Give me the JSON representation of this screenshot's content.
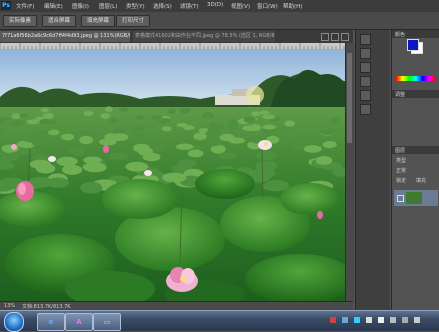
{
  "menubar": {
    "app_logo": "Ps",
    "items": [
      "文件(F)",
      "编辑(E)",
      "图像(I)",
      "图层(L)",
      "类型(Y)",
      "选择(S)",
      "滤镜(T)",
      "3D(D)",
      "视图(V)",
      "窗口(W)",
      "帮助(H)"
    ]
  },
  "options_bar": {
    "buttons": [
      "实际像素",
      "适合屏幕",
      "填充屏幕",
      "打印尺寸"
    ]
  },
  "tabs": {
    "active": "7f71a6f56b2a6c9c6d7ff4f4d93.jpeg @ 131%(RGB/8) *",
    "inactive": "表格模式41602和由作业不同.jpeg @ 78.5% (选区 1, RGB/8)"
  },
  "status": {
    "zoom": "13%",
    "doc": "文档:813.7K/813.7K"
  },
  "right_panel": {
    "labels": [
      "颜色",
      "调整",
      "图层",
      "类型",
      "正常",
      "锁定",
      "填充"
    ],
    "colors": {
      "foreground": "#0a14c8",
      "background": "#ffffff"
    }
  },
  "colors": {
    "ui_dark": "#3c3c3c",
    "ui_mid": "#535353",
    "taskbar": "#3b4c66"
  }
}
